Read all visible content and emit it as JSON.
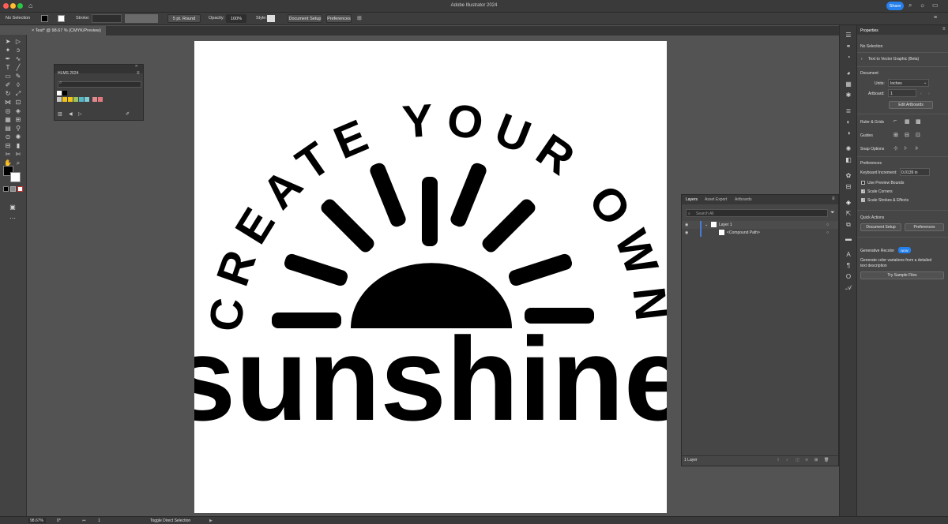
{
  "app": {
    "title": "Adobe Illustrator 2024",
    "share_label": "Share"
  },
  "control_bar": {
    "selection": "No Selection",
    "stroke_label": "Stroke:",
    "brush": "5 pt. Round",
    "opacity_label": "Opacity:",
    "opacity_value": "100%",
    "style_label": "Style:",
    "document_setup": "Document Setup",
    "preferences": "Preferences"
  },
  "document_tab": {
    "title": "Test* @ 98.67 % (CMYK/Preview)"
  },
  "swatches_panel": {
    "title": "HLMS 2024",
    "colors": [
      "#ffffff",
      "#000000",
      "#f2c318",
      "#9bc45b",
      "#56b8c4",
      "#7ecad5",
      "#e38a8e",
      "#e3787e"
    ]
  },
  "artwork": {
    "arc_text": "CREATE YOUR OWN",
    "main_text": "sunshine"
  },
  "layers_panel": {
    "tabs": [
      "Layers",
      "Asset Export",
      "Artboards"
    ],
    "search_placeholder": "Search All",
    "layer_name": "Layer 1",
    "sublayer_name": "<Compound Path>",
    "footer": "1 Layer"
  },
  "properties_panel": {
    "tab": "Properties",
    "no_selection": "No Selection",
    "text_to_vector": "Text to Vector Graphic (Beta)",
    "document_heading": "Document",
    "units_label": "Units:",
    "units_value": "Inches",
    "artboard_label": "Artboard:",
    "artboard_value": "1",
    "edit_artboards": "Edit Artboards",
    "ruler_grids": "Ruler & Grids",
    "guides": "Guides",
    "snap_options": "Snap Options",
    "preferences_heading": "Preferences",
    "keyboard_increment_label": "Keyboard Increment:",
    "keyboard_increment_value": "0.0139 in",
    "use_preview_bounds": "Use Preview Bounds",
    "scale_corners": "Scale Corners",
    "scale_strokes": "Scale Strokes & Effects",
    "quick_actions": "Quick Actions",
    "document_setup": "Document Setup",
    "preferences": "Preferences",
    "generative_recolor": "Generative Recolor",
    "new_badge": "NEW",
    "recolor_desc_1": "Generate color variations from a detailed",
    "recolor_desc_2": "text description",
    "try_sample": "Try Sample Files"
  },
  "status_bar": {
    "zoom": "98.67%",
    "rotation": "0°",
    "artboard_nav": "1",
    "tool_hint": "Toggle Direct Selection"
  }
}
